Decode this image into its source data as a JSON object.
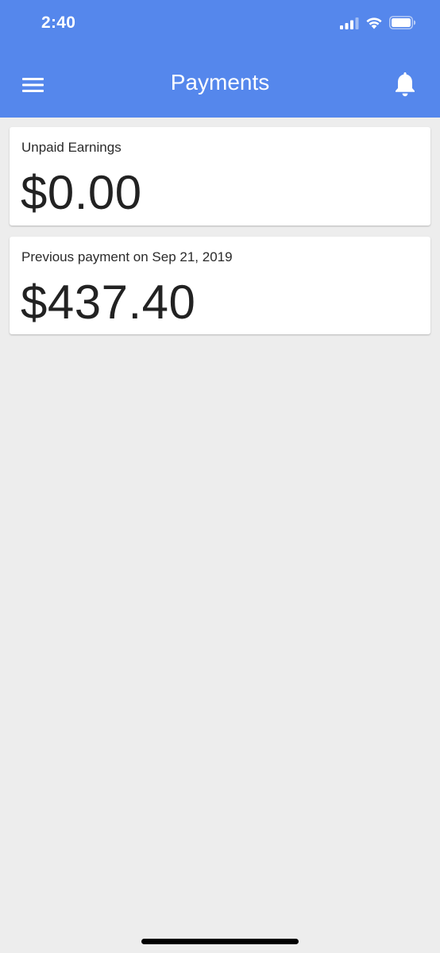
{
  "status_bar": {
    "time": "2:40"
  },
  "app_bar": {
    "title": "Payments",
    "background_color": "#5587ec"
  },
  "cards": [
    {
      "label": "Unpaid Earnings",
      "amount": "$0.00"
    },
    {
      "label": "Previous payment on Sep 21, 2019",
      "amount": "$437.40"
    }
  ],
  "icons": {
    "menu": "hamburger-menu-icon",
    "notifications": "bell-icon",
    "signal": "cellular-signal-icon",
    "wifi": "wifi-icon",
    "battery": "battery-icon"
  }
}
